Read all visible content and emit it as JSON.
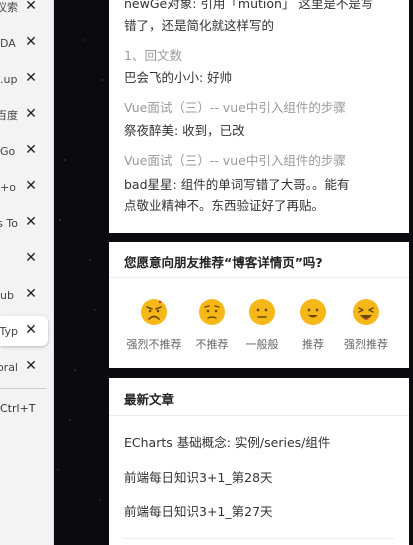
{
  "tabs": [
    {
      "title": "建议索",
      "close": "✕",
      "active": false
    },
    {
      "title": "DA",
      "close": "✕",
      "active": false
    },
    {
      "title": "up.",
      "close": "✕",
      "active": false
    },
    {
      "title": "百度",
      "close": "✕",
      "active": false
    },
    {
      "title": "Go",
      "close": "✕",
      "active": false
    },
    {
      "title": "o+",
      "close": "✕",
      "active": false
    },
    {
      "title": "s To",
      "close": "✕",
      "active": false
    },
    {
      "title": "",
      "close": "✕",
      "active": false
    },
    {
      "title": "ub",
      "close": "✕",
      "active": false
    },
    {
      "title": "Typ",
      "close": "✕",
      "active": true
    },
    {
      "title": "oral",
      "close": "✕",
      "active": false
    }
  ],
  "shortcut": "Ctrl+T",
  "comments": {
    "line1": "newGe对象: 引用「mution」 这里是不是写",
    "line2": "错了，还是简化就这样写的",
    "ref1": "1、回文数",
    "reply1": "巴会飞的小小: 好帅",
    "ref2": "Vue面试（三）-- vue中引入组件的步骤",
    "reply2": "祭夜醉美: 收到，已改",
    "ref3": "Vue面试（三）-- vue中引入组件的步骤",
    "reply3_line1": "bad星星: 组件的单词写错了大哥。。能有",
    "reply3_line2": "点敬业精神不。东西验证好了再贴。"
  },
  "recommend": {
    "title": "您愿意向朋友推荐“博客详情页”吗?",
    "options": [
      {
        "label": "强烈不推荐",
        "icon": "angry-face-icon"
      },
      {
        "label": "不推荐",
        "icon": "worried-face-icon"
      },
      {
        "label": "一般般",
        "icon": "neutral-face-icon"
      },
      {
        "label": "推荐",
        "icon": "smiling-face-icon"
      },
      {
        "label": "强烈推荐",
        "icon": "laughing-face-icon"
      }
    ],
    "emoji_color": "#f5b818"
  },
  "articles": {
    "title": "最新文章",
    "items": [
      "ECharts 基础概念: 实例/series/组件",
      "前端每日知识3+1_第28天",
      "前端每日知识3+1_第27天"
    ]
  }
}
